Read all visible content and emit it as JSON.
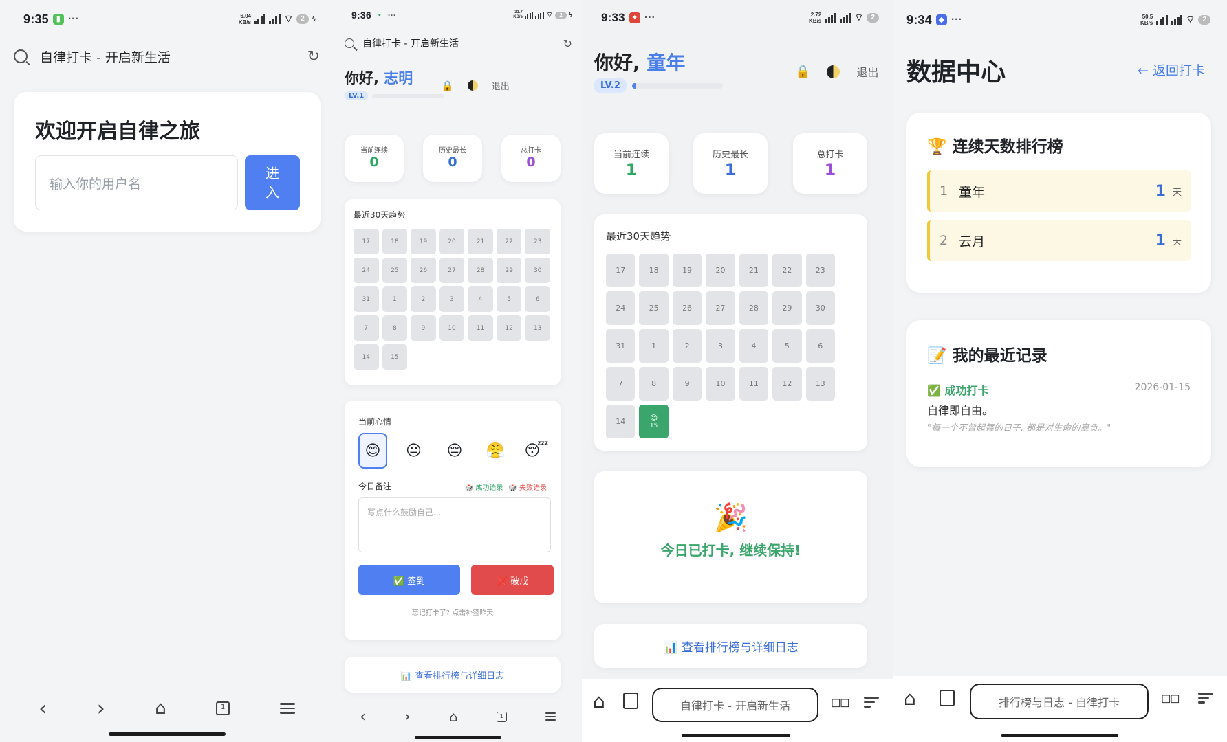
{
  "screens": {
    "login": {
      "status": {
        "time": "9:35",
        "net": "6.04\nKB/s",
        "battery": "2"
      },
      "url_title": "自律打卡 - 开启新生活",
      "welcome_title": "欢迎开启自律之旅",
      "username_placeholder": "输入你的用户名",
      "enter_button": "进入"
    },
    "checkin": {
      "status": {
        "time": "9:36",
        "net": "31.7\nKB/s",
        "battery": "2"
      },
      "url_title": "自律打卡 - 开启新生活",
      "greeting": "你好,",
      "username": "志明",
      "level": "LV.1",
      "level_progress": 0,
      "logout": "退出",
      "stats": [
        {
          "label": "当前连续",
          "value": "0",
          "color": "#2fa862"
        },
        {
          "label": "历史最长",
          "value": "0",
          "color": "#3b6fd8"
        },
        {
          "label": "总打卡",
          "value": "0",
          "color": "#9b4fd9"
        }
      ],
      "trend_title": "最近30天趋势",
      "days": [
        "17",
        "18",
        "19",
        "20",
        "21",
        "22",
        "23",
        "24",
        "25",
        "26",
        "27",
        "28",
        "29",
        "30",
        "31",
        "1",
        "2",
        "3",
        "4",
        "5",
        "6",
        "7",
        "8",
        "9",
        "10",
        "11",
        "12",
        "13",
        "14",
        "15"
      ],
      "mood_label": "当前心情",
      "moods": [
        "😊",
        "😐",
        "😔",
        "😤",
        "😴"
      ],
      "note_label": "今日备注",
      "success_quote_link": "成功语录",
      "fail_quote_link": "失败语录",
      "note_placeholder": "写点什么鼓励自己...",
      "sign_button": "✅ 签到",
      "break_button": "❌ 破戒",
      "makeup_hint": "忘记打卡了? 点击补签昨天",
      "leaderboard_link": "📊 查看排行榜与详细日志"
    },
    "checked": {
      "status": {
        "time": "9:33",
        "net": "2.72\nKB/s",
        "battery": "2"
      },
      "greeting": "你好,",
      "username": "童年",
      "level": "LV.2",
      "level_progress": 0.04,
      "logout": "退出",
      "stats": [
        {
          "label": "当前连续",
          "value": "1",
          "color": "#2fa862"
        },
        {
          "label": "历史最长",
          "value": "1",
          "color": "#3b6fd8"
        },
        {
          "label": "总打卡",
          "value": "1",
          "color": "#9b4fd9"
        }
      ],
      "trend_title": "最近30天趋势",
      "days": [
        "17",
        "18",
        "19",
        "20",
        "21",
        "22",
        "23",
        "24",
        "25",
        "26",
        "27",
        "28",
        "29",
        "30",
        "31",
        "1",
        "2",
        "3",
        "4",
        "5",
        "6",
        "7",
        "8",
        "9",
        "10",
        "11",
        "12",
        "13",
        "14",
        "15"
      ],
      "done_day_emoji": "😊",
      "done_message_emoji": "🎉",
      "done_message": "今日已打卡, 继续保持!",
      "leaderboard_link": "📊 查看排行榜与详细日志",
      "address_bar": "自律打卡 - 开启新生活"
    },
    "data": {
      "status": {
        "time": "9:34",
        "net": "50.5\nKB/s",
        "battery": "2"
      },
      "title": "数据中心",
      "back_link": "← 返回打卡",
      "ranking_title": "🏆 连续天数排行榜",
      "ranking": [
        {
          "rank": "1",
          "name": "童年",
          "days": "1",
          "unit": "天"
        },
        {
          "rank": "2",
          "name": "云月",
          "days": "1",
          "unit": "天"
        }
      ],
      "records_title": "📝 我的最近记录",
      "record_status": "✅ 成功打卡",
      "record_date": "2026-01-15",
      "record_text": "自律即自由。",
      "record_quote": "\"每一个不曾起舞的日子, 都是对生命的辜负。\"",
      "address_bar": "排行榜与日志 - 自律打卡"
    }
  },
  "colors": {
    "accent": "#4f7ff0",
    "success": "#3aa66b",
    "danger": "#e24b4b",
    "gold": "#f0c93a"
  }
}
